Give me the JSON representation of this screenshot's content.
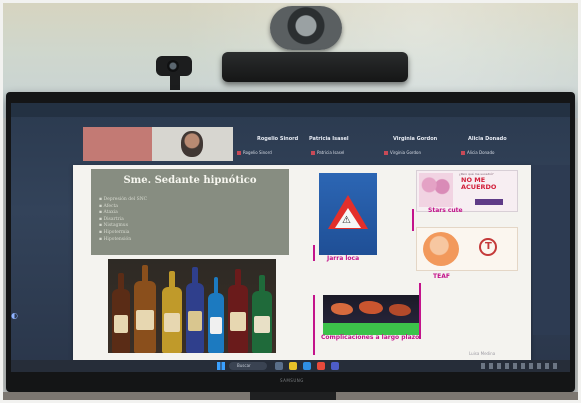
{
  "call": {
    "participants": [
      {
        "name": "Rogelio Sinord",
        "tag": "Rogelio Sinord"
      },
      {
        "name": "Patricia Isasel",
        "tag": "Patricia Isasel"
      },
      {
        "name": "Virginia Gordon",
        "tag": "Virginia Gordon"
      },
      {
        "name": "Alicia Donado",
        "tag": "Alicia Donado"
      }
    ]
  },
  "slide": {
    "title": "Sme. Sedante hipnótico",
    "bullets": [
      "Depresión del SNC",
      "Afecta",
      "Ataxia",
      "Disartria",
      "Nistagmus",
      "Hipotermia",
      "Hipotensión"
    ],
    "captions": {
      "jarra": "Jarra loca",
      "stars": "Stars cute",
      "teaf": "TEAF",
      "complicaciones": "Complicaciones a largo plazo"
    },
    "poster": {
      "small_text": "¿Pero qué me sucedió?",
      "big_text_1": "NO ME",
      "big_text_2": "ACUERDO"
    },
    "credit": "Luisa Medina"
  },
  "taskbar": {
    "search_label": "Buscar"
  },
  "monitor": {
    "brand": "SAMSUNG"
  },
  "colors": {
    "accent_pink": "#c3138b",
    "slide_background": "#f4f3ef",
    "title_box": "#878d81",
    "sign_blue": "#2c66b4"
  }
}
